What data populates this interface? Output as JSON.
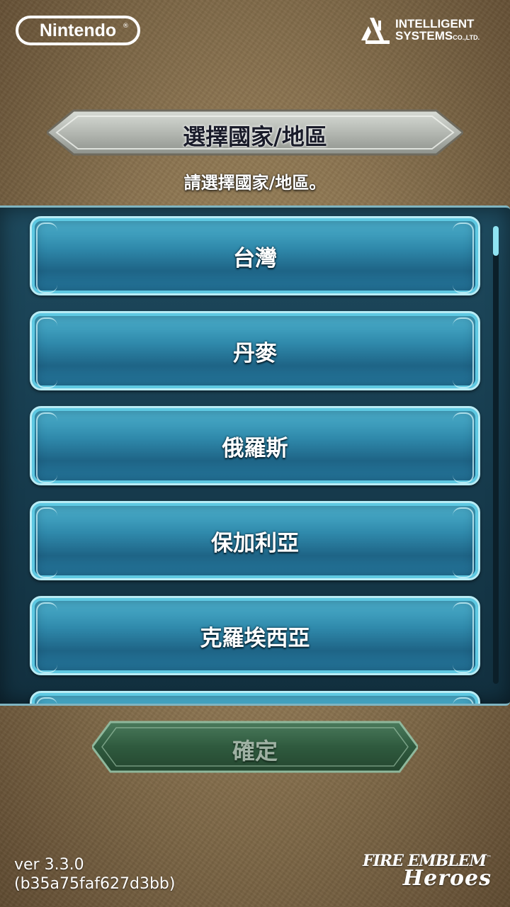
{
  "header": {
    "nintendo_logo": "Nintendo",
    "intelligent_systems": {
      "line1": "INTELLIGENT",
      "line2": "SYSTEMS",
      "suffix": "CO.,LTD."
    }
  },
  "title": "選擇國家/地區",
  "subtitle": "請選擇國家/地區。",
  "countries": [
    {
      "label": "台灣"
    },
    {
      "label": "丹麥"
    },
    {
      "label": "俄羅斯"
    },
    {
      "label": "保加利亞"
    },
    {
      "label": "克羅埃西亞"
    },
    {
      "label": ""
    }
  ],
  "confirm_label": "確定",
  "version": {
    "line1": "ver 3.3.0",
    "line2": "(b35a75faf627d3bb)"
  },
  "game_logo": {
    "line1": "FIRE EMBLEM",
    "line2": "Heroes",
    "tm": "™"
  },
  "colors": {
    "background": "#8a7350",
    "panel": "#1e4a5e",
    "item": "#2f89ab",
    "item_border": "#b9ecf5",
    "confirm": "#2f5a3e",
    "title_plate": "#b8bcb8"
  },
  "scroll_position": 0
}
